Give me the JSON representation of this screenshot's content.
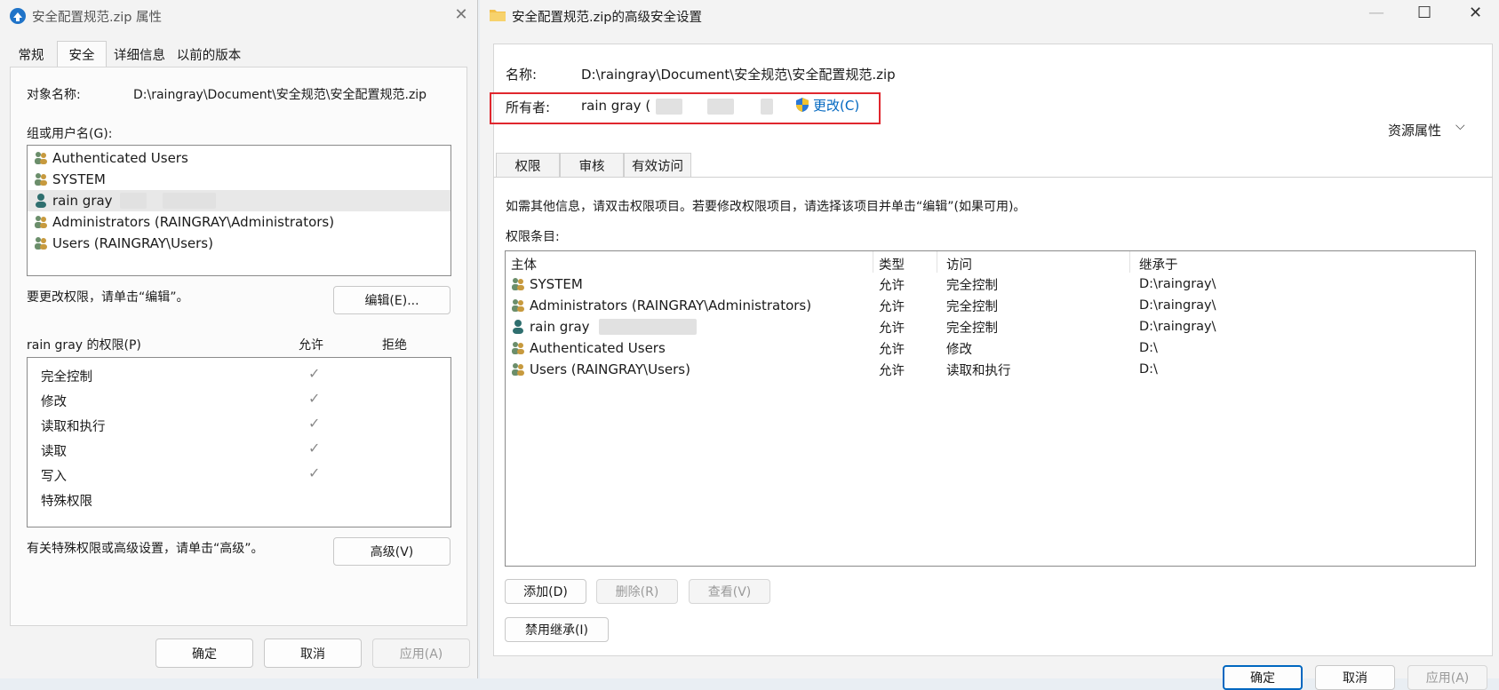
{
  "left": {
    "title": "安全配置规范.zip 属性",
    "tabs": [
      "常规",
      "安全",
      "详细信息",
      "以前的版本"
    ],
    "object_label": "对象名称:",
    "object_value": "D:\\raingray\\Document\\安全规范\\安全配置规范.zip",
    "groups_label": "组或用户名(G):",
    "groups": [
      {
        "name": "Authenticated Users",
        "icon": "group-icon"
      },
      {
        "name": "SYSTEM",
        "icon": "group-icon"
      },
      {
        "name": "rain gray",
        "icon": "user-icon"
      },
      {
        "name": "Administrators (RAINGRAY\\Administrators)",
        "icon": "group-icon"
      },
      {
        "name": "Users (RAINGRAY\\Users)",
        "icon": "group-icon"
      }
    ],
    "edit_hint": "要更改权限，请单击“编辑”。",
    "edit_button": "编辑(E)...",
    "perm_title": "rain gray 的权限(P)",
    "allow_header": "允许",
    "deny_header": "拒绝",
    "permissions": [
      {
        "name": "完全控制",
        "allow": true
      },
      {
        "name": "修改",
        "allow": true
      },
      {
        "name": "读取和执行",
        "allow": true
      },
      {
        "name": "读取",
        "allow": true
      },
      {
        "name": "写入",
        "allow": true
      },
      {
        "name": "特殊权限",
        "allow": false
      }
    ],
    "check_glyph": "✓",
    "advanced_hint": "有关特殊权限或高级设置，请单击“高级”。",
    "advanced_button": "高级(V)",
    "ok_button": "确定",
    "cancel_button": "取消",
    "apply_button": "应用(A)"
  },
  "right": {
    "title": "安全配置规范.zip的高级安全设置",
    "name_label": "名称:",
    "name_value": "D:\\raingray\\Document\\安全规范\\安全配置规范.zip",
    "owner_label": "所有者:",
    "owner_value": "rain gray (",
    "owner_change": "更改(C)",
    "resource_props": "资源属性",
    "tabs": [
      "权限",
      "审核",
      "有效访问"
    ],
    "info_text": "如需其他信息，请双击权限项目。若要修改权限项目，请选择该项目并单击“编辑”(如果可用)。",
    "entries_label": "权限条目:",
    "columns": [
      "主体",
      "类型",
      "访问",
      "继承于"
    ],
    "entries": [
      {
        "principal": "SYSTEM",
        "type": "允许",
        "access": "完全控制",
        "inherited": "D:\\raingray\\",
        "icon": "group-icon"
      },
      {
        "principal": "Administrators (RAINGRAY\\Administrators)",
        "type": "允许",
        "access": "完全控制",
        "inherited": "D:\\raingray\\",
        "icon": "group-icon"
      },
      {
        "principal": "rain gray",
        "type": "允许",
        "access": "完全控制",
        "inherited": "D:\\raingray\\",
        "icon": "user-icon"
      },
      {
        "principal": "Authenticated Users",
        "type": "允许",
        "access": "修改",
        "inherited": "D:\\",
        "icon": "group-icon"
      },
      {
        "principal": "Users (RAINGRAY\\Users)",
        "type": "允许",
        "access": "读取和执行",
        "inherited": "D:\\",
        "icon": "group-icon"
      }
    ],
    "add_button": "添加(D)",
    "remove_button": "删除(R)",
    "view_button": "查看(V)",
    "disable_inherit_button": "禁用继承(I)",
    "ok_button": "确定",
    "cancel_button": "取消",
    "apply_button": "应用(A)"
  },
  "colors": {
    "accent": "#0067c0",
    "highlight_box": "#e0272e",
    "selected_row": "#e8e8e8"
  }
}
